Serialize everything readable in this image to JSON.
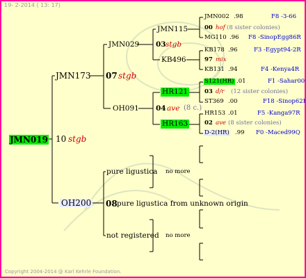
{
  "header": {
    "text": "19- 2-2014 ( 13: 17)"
  },
  "footer": {
    "text": "Copyright 2004-2014 @ Karl Kehrle Foundation."
  },
  "colors": {
    "background": "#ffffcc",
    "border": "#ff0099",
    "highlight": "#00ee00",
    "note": "#cc0000",
    "info": "#0000cc"
  },
  "root": {
    "id": "JMN019",
    "num": "10",
    "note": "stgb"
  },
  "sire": {
    "id": "JMN173",
    "num": "07",
    "note": "stgb"
  },
  "dam": {
    "id": "OH200",
    "num": "08",
    "text": "pure ligustica from unknown origin"
  },
  "ss": {
    "id": "JMN029",
    "num": "03",
    "note": "stgb"
  },
  "sd": {
    "id": "OH091",
    "num": "04",
    "note": "ave",
    "extra": "(8 c.)"
  },
  "sss": {
    "id": "JMN115"
  },
  "ssd": {
    "id": "KB496"
  },
  "sds": {
    "id": "HR121"
  },
  "sdd": {
    "id": "HR163"
  },
  "ds": {
    "id": "pure ligustica",
    "nomore": "no more"
  },
  "dd": {
    "id": "not registered",
    "nomore": "no more"
  },
  "gen4": {
    "r1": {
      "id": "JMN002",
      "val": ".98",
      "info": "F8 -3-66"
    },
    "r2": {
      "num": "00",
      "note": "hof",
      "sis": "(8 sister colonies)"
    },
    "r3": {
      "id": "MG110",
      "val": ".96",
      "info": "F8 -SinopEgg86R"
    },
    "r4": {
      "id": "KB178",
      "val": ".96",
      "info": "F3 -Egypt94-2R"
    },
    "r5": {
      "num": "97",
      "note": "mix"
    },
    "r6": {
      "id": "KB131",
      "val": ".94",
      "info": "F4 -Kenya4R"
    },
    "r7": {
      "id": "S121(HR)",
      "val": ".01",
      "info": "F1 -Sahar00Q"
    },
    "r8": {
      "num": "03",
      "note": "d/r",
      "sis": "(12 sister colonies)"
    },
    "r9": {
      "id": "ST369",
      "val": ".00",
      "info": "F18 -Sinop62R"
    },
    "r10": {
      "id": "HR153",
      "val": ".01",
      "info": "F5 -Kanga97R"
    },
    "r11": {
      "num": "02",
      "note": "ave",
      "sis": "(8 sister colonies)"
    },
    "r12": {
      "id": "D-2(HR)",
      "val": ".99",
      "info": "F0 -Maced99Q"
    }
  }
}
